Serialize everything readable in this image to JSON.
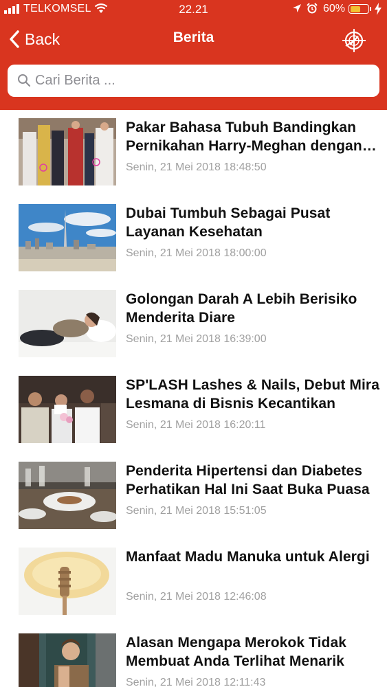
{
  "status_bar": {
    "carrier": "TELKOMSEL",
    "time": "22.21",
    "battery_percent": "60%",
    "battery_level": 0.6,
    "battery_color": "#f2c232"
  },
  "nav": {
    "back_label": "Back",
    "title": "Berita",
    "right_icon": "compass-logo-icon"
  },
  "search": {
    "placeholder": "Cari Berita ...",
    "value": ""
  },
  "colors": {
    "header": "#d9351f",
    "title_text": "#111111",
    "date_text": "#a0a0a0"
  },
  "news": [
    {
      "title": "Pakar Bahasa Tubuh Bandingkan Pernikahan Harry-Meghan dengan Kate-William",
      "date": "Senin, 21 Mei 2018 18:48:50",
      "thumb": "royal-wedding-image"
    },
    {
      "title": "Dubai Tumbuh Sebagai Pusat Layanan Kesehatan",
      "date": "Senin, 21 Mei 2018 18:00:00",
      "thumb": "dubai-skyline-image"
    },
    {
      "title": "Golongan Darah A Lebih Berisiko Menderita Diare",
      "date": "Senin, 21 Mei 2018 16:39:00",
      "thumb": "woman-lying-image"
    },
    {
      "title": "SP'LASH Lashes & Nails, Debut Mira Lesmana di Bisnis Kecantikan",
      "date": "Senin, 21 Mei 2018 16:20:11",
      "thumb": "salon-launch-image"
    },
    {
      "title": "Penderita Hipertensi dan Diabetes Perhatikan Hal Ini Saat Buka Puasa",
      "date": "Senin, 21 Mei 2018 15:51:05",
      "thumb": "dining-table-image"
    },
    {
      "title": "Manfaat Madu Manuka untuk Alergi",
      "date": "Senin, 21 Mei 2018 12:46:08",
      "thumb": "honey-dipper-image"
    },
    {
      "title": "Alasan Mengapa Merokok Tidak Membuat Anda Terlihat Menarik",
      "date": "Senin, 21 Mei 2018 12:11:43",
      "thumb": "man-smoking-image"
    }
  ]
}
